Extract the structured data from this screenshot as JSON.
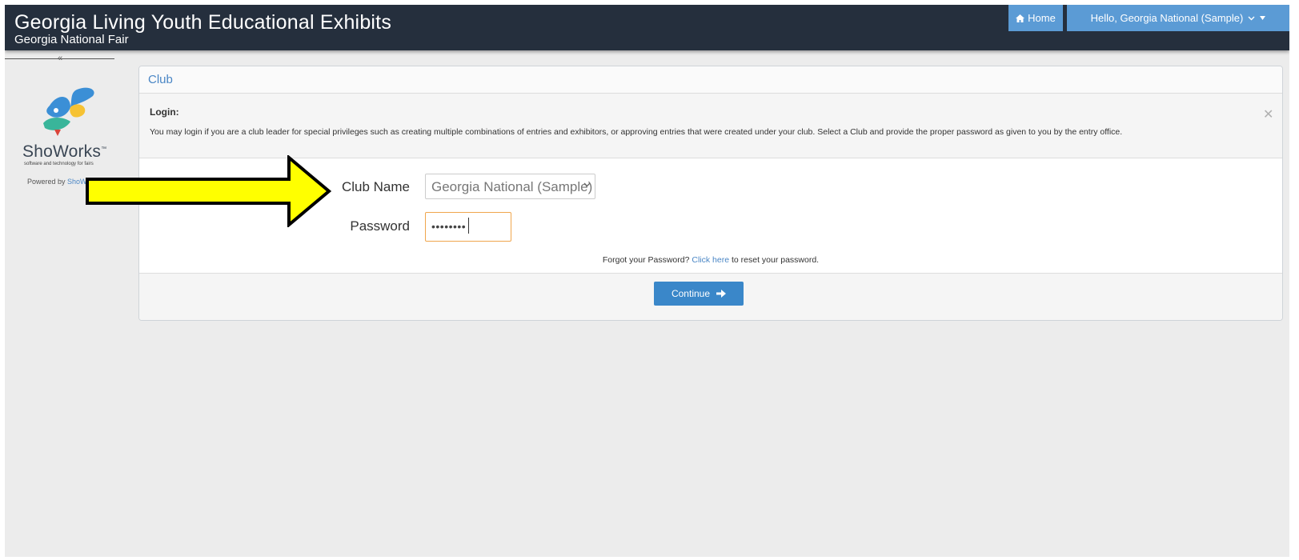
{
  "header": {
    "title": "Georgia Living Youth Educational Exhibits",
    "subtitle": "Georgia National Fair",
    "home_label": "Home",
    "user_label": "Hello, Georgia National (Sample)",
    "home_icon": "home-icon",
    "user_menu_icon": "chevron-down-icon"
  },
  "sidebar": {
    "collapse_glyph": "«",
    "brand": "ShoWorks",
    "brand_mark": "™",
    "tagline": "software and technology for fairs",
    "powered_prefix": "Powered by",
    "powered_link": "ShoWorks"
  },
  "panel": {
    "title": "Club",
    "notice": {
      "title": "Login:",
      "text": "You may login if you are a club leader for special privileges such as creating multiple combinations of entries and exhibitors, or approving entries that were created under your club. Select a Club and provide the proper password as given to you by the entry office.",
      "close_glyph": "✕"
    },
    "form": {
      "club_label": "Club Name",
      "club_value": "Georgia National (Sample)",
      "password_label": "Password",
      "password_value": "••••••••"
    },
    "forgot": {
      "prefix": "Forgot your Password?",
      "link": "Click here",
      "suffix": "to reset your password."
    },
    "continue_label": "Continue",
    "continue_icon": "arrow-right-icon"
  },
  "colors": {
    "topbar": "#252f3d",
    "accent": "#5b9bd5",
    "button": "#3a87c9",
    "annotation": "#ffff00"
  }
}
